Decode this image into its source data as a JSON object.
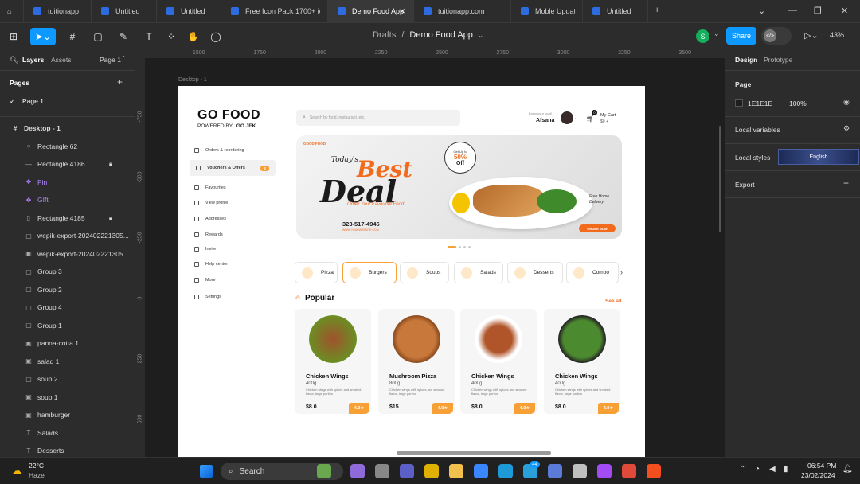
{
  "tabs": [
    {
      "label": "tuitionapp",
      "active": false
    },
    {
      "label": "Untitled",
      "active": false
    },
    {
      "label": "Untitled",
      "active": false
    },
    {
      "label": "Free Icon Pack 1700+ ico",
      "active": false
    },
    {
      "label": "Demo Food App",
      "active": true
    },
    {
      "label": "tuitionapp.com",
      "active": false
    },
    {
      "label": "Moble Update",
      "active": false
    },
    {
      "label": "Untitled",
      "active": false
    }
  ],
  "toolbar": {
    "breadcrumb_drafts": "Drafts",
    "breadcrumb_sep": "/",
    "file_name": "Demo Food App",
    "avatar_letter": "S",
    "share_label": "Share",
    "zoom": "43%"
  },
  "left_panel": {
    "tab_layers": "Layers",
    "tab_assets": "Assets",
    "page_selector": "Page 1",
    "pages_heading": "Pages",
    "page_item": "Page 1",
    "layers": [
      {
        "name": "Desktop - 1",
        "icon": "frame-icon",
        "glyph": "#"
      },
      {
        "name": "Rectangle 62",
        "icon": "ellipse-icon",
        "glyph": "○"
      },
      {
        "name": "Rectangle 4186",
        "icon": "line-icon",
        "glyph": "—",
        "locked": true
      },
      {
        "name": "Pin",
        "icon": "component-icon",
        "glyph": "✥"
      },
      {
        "name": "GIft",
        "icon": "component-icon",
        "glyph": "✥"
      },
      {
        "name": "Rectangle 4185",
        "icon": "rectangle-icon",
        "glyph": "▯",
        "locked": true
      },
      {
        "name": "wepik-export-202402221305...",
        "icon": "rectangle-icon",
        "glyph": "▢"
      },
      {
        "name": "wepik-export-202402221305...",
        "icon": "image-icon",
        "glyph": "▣"
      },
      {
        "name": "Group 3",
        "icon": "group-icon",
        "glyph": "▢"
      },
      {
        "name": "Group 2",
        "icon": "group-icon",
        "glyph": "▢"
      },
      {
        "name": "Group 4",
        "icon": "group-icon",
        "glyph": "▢"
      },
      {
        "name": "Group 1",
        "icon": "group-icon",
        "glyph": "▢"
      },
      {
        "name": "panna-cotta 1",
        "icon": "image-icon",
        "glyph": "▣"
      },
      {
        "name": "salad 1",
        "icon": "image-icon",
        "glyph": "▣"
      },
      {
        "name": "soup 2",
        "icon": "group-icon",
        "glyph": "▢"
      },
      {
        "name": "soup 1",
        "icon": "image-icon",
        "glyph": "▣"
      },
      {
        "name": "hamburger",
        "icon": "image-icon",
        "glyph": "▣"
      },
      {
        "name": "Salads",
        "icon": "text-icon",
        "glyph": "T"
      },
      {
        "name": "Desserts",
        "icon": "text-icon",
        "glyph": "T"
      }
    ]
  },
  "ruler": {
    "h": [
      "1500",
      "1750",
      "2000",
      "2250",
      "2500",
      "2750",
      "3000",
      "3250",
      "3500"
    ],
    "v": [
      "-750",
      "-500",
      "-250",
      "0",
      "250",
      "500"
    ]
  },
  "frame_label": "Desktop - 1",
  "app": {
    "logo_main": "GO FOOD",
    "logo_sub_prefix": "POWERED BY",
    "logo_sub_brand": "GO JEK",
    "search_placeholder": "Search by food, restaurant, etc.",
    "user_hint": "Enjoy your food!",
    "user_name": "Afsana",
    "cart_count": "0",
    "cart_label": "My Cart",
    "cart_amount": "$0 +",
    "nav": [
      {
        "label": "Orders & reordering"
      },
      {
        "label": "Vouchers & Offers",
        "active": true,
        "badge": "2"
      },
      {
        "label": "Favourites"
      },
      {
        "label": "View profile"
      },
      {
        "label": "Addresses"
      },
      {
        "label": "Rewards"
      },
      {
        "label": "Invite"
      },
      {
        "label": "Help center"
      },
      {
        "label": "More"
      },
      {
        "label": "Settings"
      }
    ],
    "banner": {
      "brand": "GOOD FOOD",
      "small_title": "Today's",
      "title1": "Best",
      "title2": "Deal",
      "subtitle": "Order Your Favourite Food",
      "phone": "323-517-4946",
      "website": "WWW.YOURWEBSITE.COM",
      "offer_line1": "Get Up to",
      "offer_line2": "50%",
      "offer_line3": "Off",
      "free_delivery": "Free Home Delivery",
      "order_now": "ORDER NOW"
    },
    "categories": [
      "Pizza",
      "Burgers",
      "Soups",
      "Salads",
      "Desserts",
      "Combo"
    ],
    "popular_title": "Popular",
    "see_all": "See all",
    "items": [
      {
        "name": "Chicken Wings",
        "weight": "400g",
        "desc": "Chicken wings with spices and smoked flavor, large portion",
        "price": "$8.0",
        "rating": "4.0★"
      },
      {
        "name": "Mushroom Pizza",
        "weight": "800g",
        "desc": "Chicken wings with spices and smoked flavor, large portion",
        "price": "$15",
        "rating": "4.0★"
      },
      {
        "name": "Chicken Wings",
        "weight": "400g",
        "desc": "Chicken wings with spices and smoked flavor, large portion",
        "price": "$8.0",
        "rating": "4.0★"
      },
      {
        "name": "Chicken Wings",
        "weight": "400g",
        "desc": "Chicken wings with spices and smoked flavor, large portion",
        "price": "$8.0",
        "rating": "4.0★"
      }
    ]
  },
  "right_panel": {
    "tab_design": "Design",
    "tab_prototype": "Prototype",
    "page_heading": "Page",
    "page_color": "1E1E1E",
    "page_opacity": "100%",
    "local_variables": "Local variables",
    "local_styles": "Local styles",
    "export": "Export",
    "english_label": "English"
  },
  "taskbar": {
    "weather_temp": "22°C",
    "weather_desc": "Haze",
    "search": "Search",
    "time": "06:54 PM",
    "date": "23/02/2024",
    "badge_count": "44"
  },
  "colors": {
    "accent_blue": "#0d99ff",
    "brand_orange": "#f26b1d",
    "rating_orange": "#f7a035",
    "avatar_green": "#14ae5c"
  }
}
